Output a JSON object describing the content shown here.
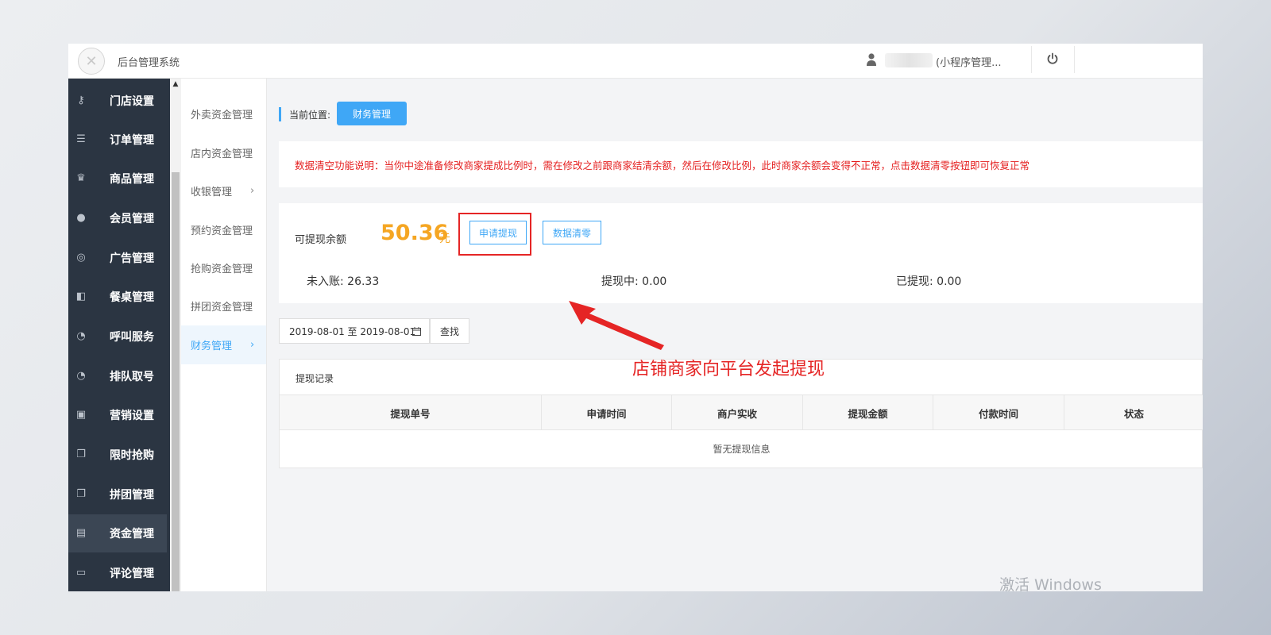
{
  "header": {
    "app_title": "后台管理系统",
    "user_role": "(小程序管理...",
    "logo_icon": "logo-icon",
    "user_icon": "user-icon",
    "power_icon": "power-icon"
  },
  "sidebar": {
    "items": [
      {
        "label": "门店设置",
        "icon": "key-icon",
        "glyph": "⚷"
      },
      {
        "label": "订单管理",
        "icon": "list-icon",
        "glyph": "☰"
      },
      {
        "label": "商品管理",
        "icon": "trophy-icon",
        "glyph": "♛"
      },
      {
        "label": "会员管理",
        "icon": "user-icon",
        "glyph": "●"
      },
      {
        "label": "广告管理",
        "icon": "lifebuoy-icon",
        "glyph": "◎"
      },
      {
        "label": "餐桌管理",
        "icon": "binoculars-icon",
        "glyph": "◧"
      },
      {
        "label": "呼叫服务",
        "icon": "dashboard-icon",
        "glyph": "◔"
      },
      {
        "label": "排队取号",
        "icon": "dashboard-icon",
        "glyph": "◔"
      },
      {
        "label": "营销设置",
        "icon": "gift-icon",
        "glyph": "▣"
      },
      {
        "label": "限时抢购",
        "icon": "copy-icon",
        "glyph": "❐"
      },
      {
        "label": "拼团管理",
        "icon": "copy-icon",
        "glyph": "❐"
      },
      {
        "label": "资金管理",
        "icon": "book-icon",
        "glyph": "▤"
      },
      {
        "label": "评论管理",
        "icon": "money-icon",
        "glyph": "▭"
      }
    ],
    "active_index": 11
  },
  "submenu": {
    "items": [
      {
        "label": "外卖资金管理",
        "arrow": ""
      },
      {
        "label": "店内资金管理",
        "arrow": ""
      },
      {
        "label": "收银管理",
        "arrow": "›"
      },
      {
        "label": "预约资金管理",
        "arrow": ""
      },
      {
        "label": "抢购资金管理",
        "arrow": ""
      },
      {
        "label": "拼团资金管理",
        "arrow": ""
      },
      {
        "label": "财务管理",
        "arrow": "›"
      }
    ],
    "active_index": 6
  },
  "breadcrumb": {
    "label": "当前位置:",
    "current": "财务管理"
  },
  "notice": {
    "text": "数据清空功能说明：当你中途准备修改商家提成比例时，需在修改之前跟商家结清余额，然后在修改比例，此时商家余额会变得不正常，点击数据清零按钮即可恢复正常"
  },
  "balance": {
    "label": "可提现余额",
    "amount": "50.36",
    "unit": "元",
    "apply_button": "申请提现",
    "clear_button": "数据清零",
    "pending_label": "未入账: 26.33",
    "withdrawing_label": "提现中: 0.00",
    "withdrawn_label": "已提现: 0.00"
  },
  "filter": {
    "date_range": "2019-08-01 至 2019-08-01",
    "search_button": "查找",
    "calendar_icon": "calendar-icon"
  },
  "annotation": {
    "text": "店铺商家向平台发起提现"
  },
  "records": {
    "title": "提现记录",
    "columns": [
      "提现单号",
      "申请时间",
      "商户实收",
      "提现金额",
      "付款时间",
      "状态"
    ],
    "empty_text": "暂无提现信息"
  },
  "watermark": {
    "text": "激活 Windows"
  },
  "colors": {
    "accent": "#3fa7f6",
    "sidebar_bg": "#2b3542",
    "amount": "#f5a623",
    "notice": "#e52020",
    "annotation": "#e52525"
  }
}
